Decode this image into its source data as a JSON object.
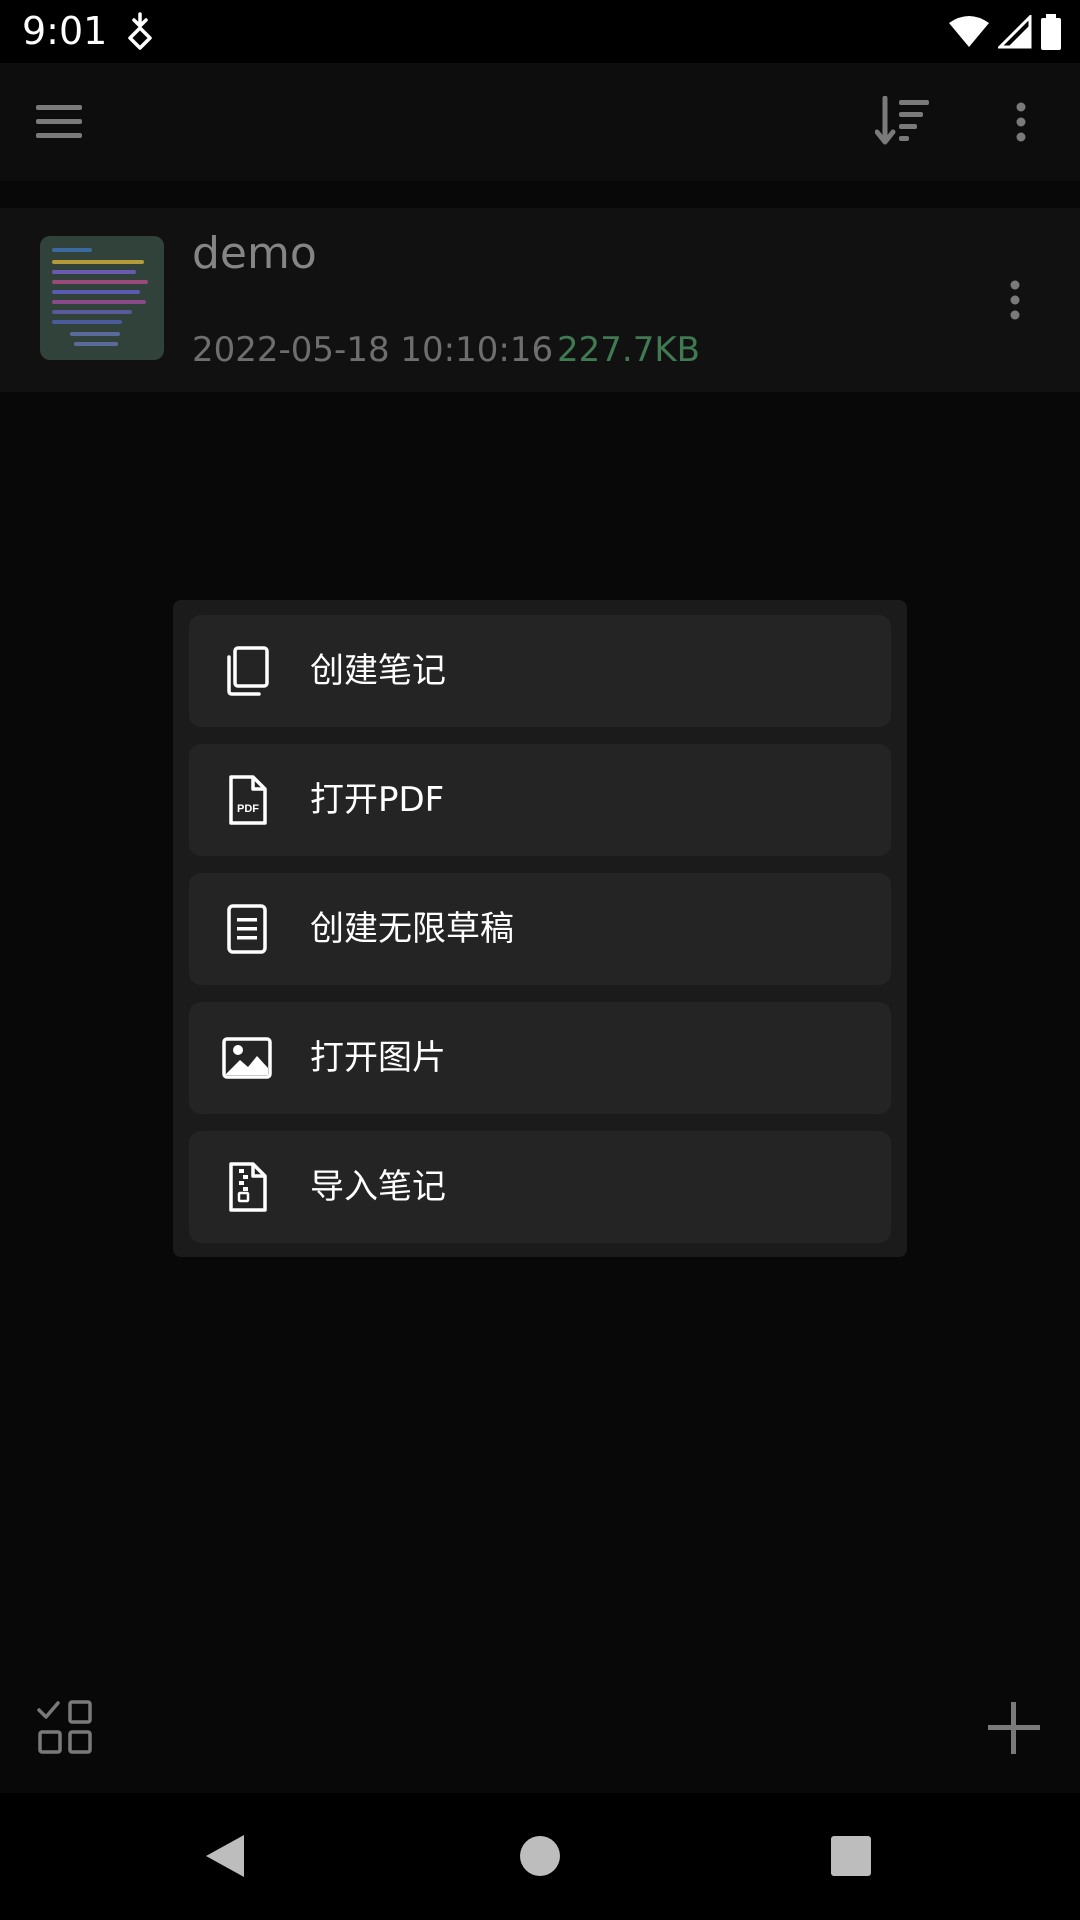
{
  "status_bar": {
    "time": "9:01",
    "icons": [
      "download-notification-icon",
      "wifi-icon",
      "signal-icon",
      "battery-icon"
    ]
  },
  "app_bar": {
    "left_icon": "menu-icon",
    "actions": [
      "sort-icon",
      "more-vert-icon"
    ]
  },
  "notes": [
    {
      "title": "demo",
      "date": "2022-05-18 10:10:16",
      "size": "227.7KB",
      "thumbnail_icon": "note-thumbnail"
    }
  ],
  "dialog": {
    "items": [
      {
        "label": "创建笔记",
        "icon": "copy-pages-icon"
      },
      {
        "label": "打开PDF",
        "icon": "pdf-file-icon"
      },
      {
        "label": "创建无限草稿",
        "icon": "document-lines-icon"
      },
      {
        "label": "打开图片",
        "icon": "image-icon"
      },
      {
        "label": "导入笔记",
        "icon": "zip-file-icon"
      }
    ]
  },
  "bottom_bar": {
    "left_icon": "select-grid-icon",
    "right_icon": "add-icon"
  },
  "nav_bar": {
    "buttons": [
      "back-icon",
      "home-icon",
      "recents-icon"
    ]
  },
  "colors": {
    "background": "#0b0b0b",
    "dialog": "#1b1b1b",
    "menu_item": "#242424",
    "size_text": "#3f7a52",
    "muted_text": "#6e6e6e"
  }
}
